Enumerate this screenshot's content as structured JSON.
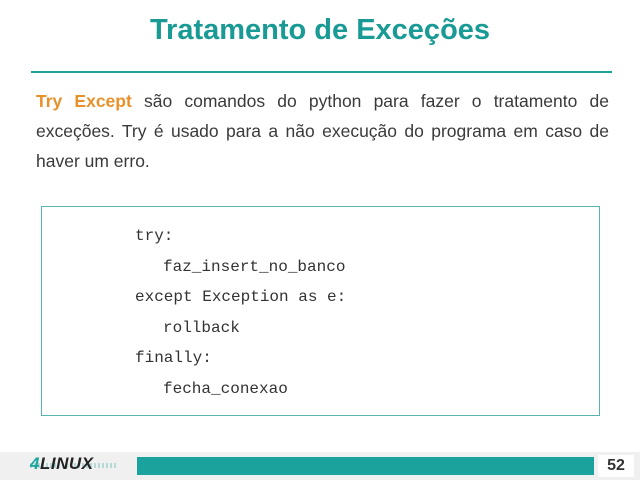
{
  "slide": {
    "title": "Tratamento de Exceções",
    "intro_highlight": "Try Except",
    "intro_rest": " são comandos do python para fazer o tratamento de exceções. Try é usado para a não execução do programa em caso de haver um erro.",
    "accent_color": "#1a9a94",
    "highlight_color": "#e8902a"
  },
  "code": {
    "lines": [
      "try:",
      "faz_insert_no_banco",
      "except Exception as e:",
      "rollback",
      "finally:",
      "fecha_conexao"
    ]
  },
  "footer": {
    "logo_prefix": "4",
    "logo_text": "LINUX",
    "page_number": "52"
  }
}
